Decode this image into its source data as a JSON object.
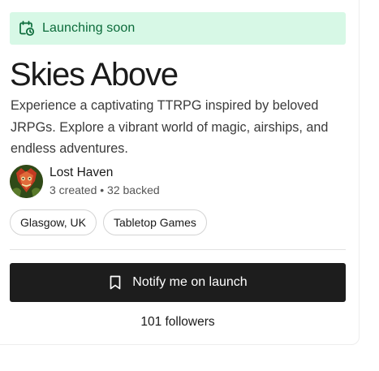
{
  "status": {
    "label": "Launching soon",
    "icon": "calendar-clock-icon",
    "color": "#0b6b3a",
    "background": "#d7f8e6"
  },
  "project": {
    "title": "Skies Above",
    "description": "Experience a captivating TTRPG inspired by beloved JRPGs. Explore a vibrant world of magic, airships, and endless adventures."
  },
  "creator": {
    "name": "Lost Haven",
    "stats": "3 created • 32 backed",
    "avatar": "creator-avatar"
  },
  "tags": [
    {
      "label": "Glasgow, UK"
    },
    {
      "label": "Tabletop Games"
    }
  ],
  "notify_button": {
    "label": "Notify me on launch",
    "icon": "bookmark-icon",
    "background": "#1d1d1d"
  },
  "followers": "101 followers"
}
